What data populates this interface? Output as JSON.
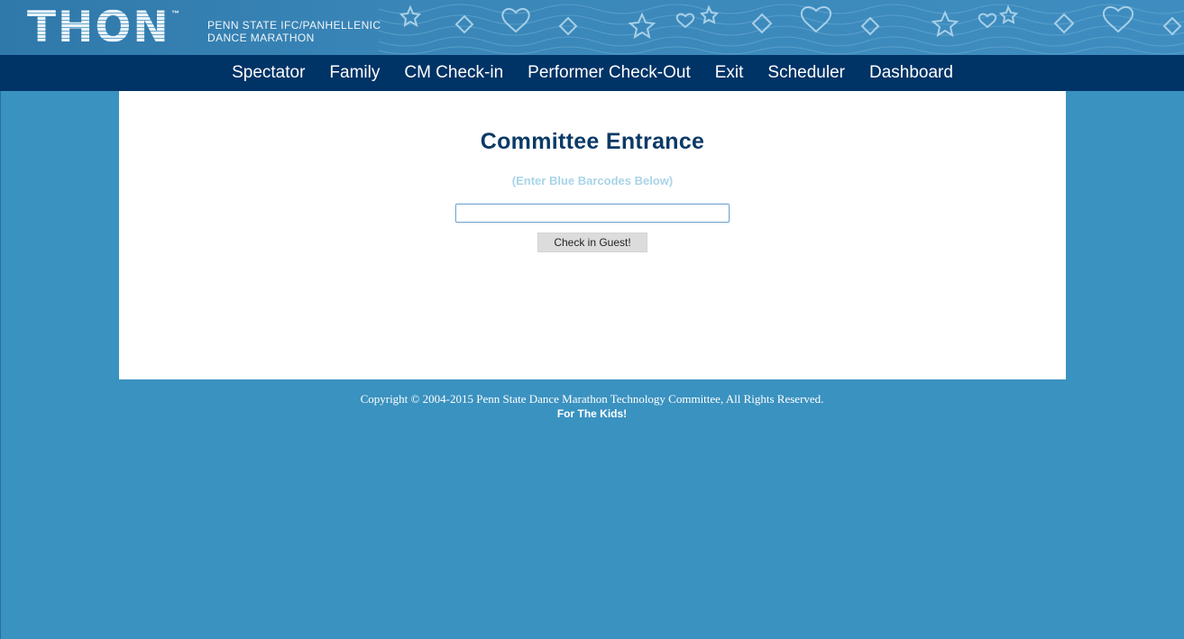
{
  "header": {
    "logo_text": "THON",
    "trademark": "™",
    "org_line1": "PENN STATE IFC/PANHELLENIC",
    "org_line2": "DANCE MARATHON",
    "banner_color": "#3a86b8"
  },
  "nav": {
    "background": "#003366",
    "items": [
      {
        "label": "Spectator"
      },
      {
        "label": "Family"
      },
      {
        "label": "CM Check-in"
      },
      {
        "label": "Performer Check-Out"
      },
      {
        "label": "Exit"
      },
      {
        "label": "Scheduler"
      },
      {
        "label": "Dashboard"
      }
    ]
  },
  "main": {
    "title": "Committee Entrance",
    "subtitle": "(Enter Blue Barcodes Below)",
    "barcode_input": {
      "value": "",
      "placeholder": ""
    },
    "checkin_button": "Check in Guest!"
  },
  "footer": {
    "copyright": "Copyright © 2004-2015 Penn State Dance Marathon Technology Committee, All Rights Reserved.",
    "tagline": "For The Kids!"
  },
  "colors": {
    "page_background": "#3a92c0",
    "title": "#0b3a66",
    "subtitle": "#a9d4e8"
  }
}
